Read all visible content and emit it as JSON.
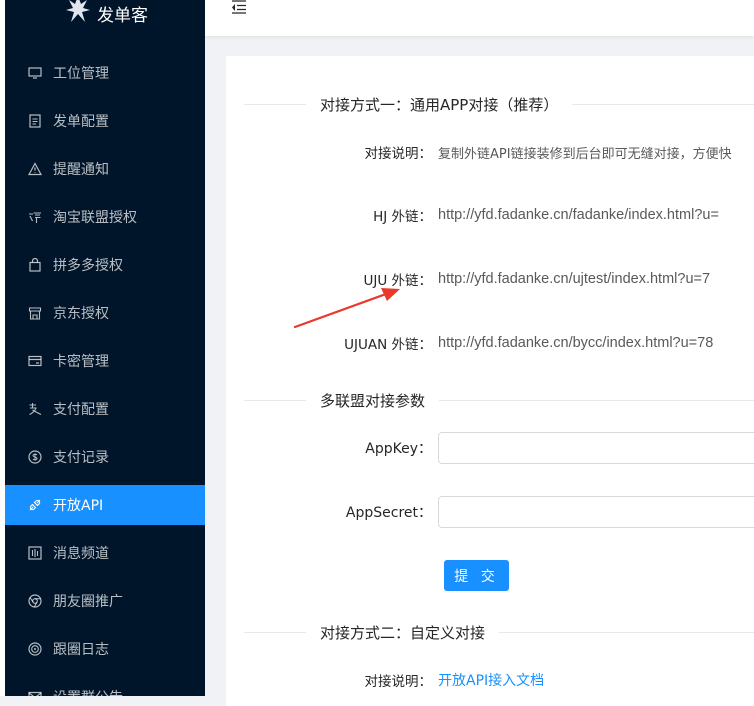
{
  "app": {
    "name": "发单客"
  },
  "sidebar": {
    "items": [
      {
        "label": "工位管理",
        "icon": "desktop-icon"
      },
      {
        "label": "发单配置",
        "icon": "file-text-icon"
      },
      {
        "label": "提醒通知",
        "icon": "warning-icon"
      },
      {
        "label": "淘宝联盟授权",
        "icon": "taobao-icon"
      },
      {
        "label": "拼多多授权",
        "icon": "shopping-icon"
      },
      {
        "label": "京东授权",
        "icon": "shop-icon"
      },
      {
        "label": "卡密管理",
        "icon": "credit-card-icon"
      },
      {
        "label": "支付配置",
        "icon": "alipay-icon"
      },
      {
        "label": "支付记录",
        "icon": "dollar-icon"
      },
      {
        "label": "开放API",
        "icon": "api-icon"
      },
      {
        "label": "消息频道",
        "icon": "sliders-icon"
      },
      {
        "label": "朋友圈推广",
        "icon": "chrome-icon"
      },
      {
        "label": "跟圈日志",
        "icon": "target-icon"
      },
      {
        "label": "设置群公告",
        "icon": "mail-icon"
      }
    ],
    "active_index": 9,
    "active_color": "#1890ff",
    "background": "#001529"
  },
  "section1": {
    "title": "对接方式一：通用APP对接（推荐）",
    "desc_label": "对接说明：",
    "desc_value": "复制外链API链接装修到后台即可无缝对接，方便快",
    "links": [
      {
        "label": "HJ 外链：",
        "value": "http://yfd.fadanke.cn/fadanke/index.html?u="
      },
      {
        "label": "UJU 外链：",
        "value": "http://yfd.fadanke.cn/ujtest/index.html?u=7"
      },
      {
        "label": "UJUAN 外链：",
        "value": "http://yfd.fadanke.cn/bycc/index.html?u=78"
      }
    ]
  },
  "section2": {
    "title": "多联盟对接参数",
    "appkey_label": "AppKey：",
    "appkey_value": "",
    "appsecret_label": "AppSecret：",
    "appsecret_value": "",
    "submit_label": "提 交"
  },
  "section3": {
    "title": "对接方式二：自定义对接",
    "desc_label": "对接说明：",
    "link_text": "开放API接入文档"
  },
  "annotation": {
    "arrow_color": "#e8392b"
  }
}
